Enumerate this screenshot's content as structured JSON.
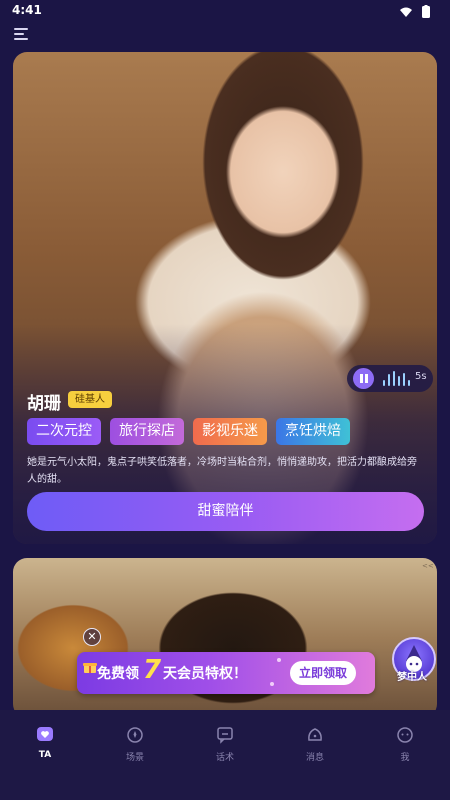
{
  "status": {
    "time": "4:41"
  },
  "character": {
    "name": "胡珊",
    "badge": "硅基人",
    "voice_duration": "5s",
    "tags": [
      "二次元控",
      "旅行探店",
      "影视乐迷",
      "烹饪烘焙"
    ],
    "description": "她是元气小太阳，鬼点子哄笑低落者，冷场时当粘合剂，悄悄递助攻，把活力都酿成给旁人的甜。",
    "cta_label": "甜蜜陪伴"
  },
  "card2_side_hint": "<<",
  "promo": {
    "prefix": "免费领",
    "number": "7",
    "suffix": "天会员特权！",
    "button_label": "立即领取",
    "mascot_label": "梦中人"
  },
  "tabs": [
    {
      "label": "TA",
      "icon": "heart-chat-icon",
      "active": true
    },
    {
      "label": "场景",
      "icon": "scene-icon",
      "active": false
    },
    {
      "label": "话术",
      "icon": "script-icon",
      "active": false
    },
    {
      "label": "消息",
      "icon": "message-icon",
      "active": false
    },
    {
      "label": "我",
      "icon": "profile-icon",
      "active": false
    }
  ],
  "colors": {
    "background": "#1b1545",
    "accent": "#8d6cf5",
    "badge": "#f7cf3e",
    "promo_number": "#ffe04a"
  }
}
